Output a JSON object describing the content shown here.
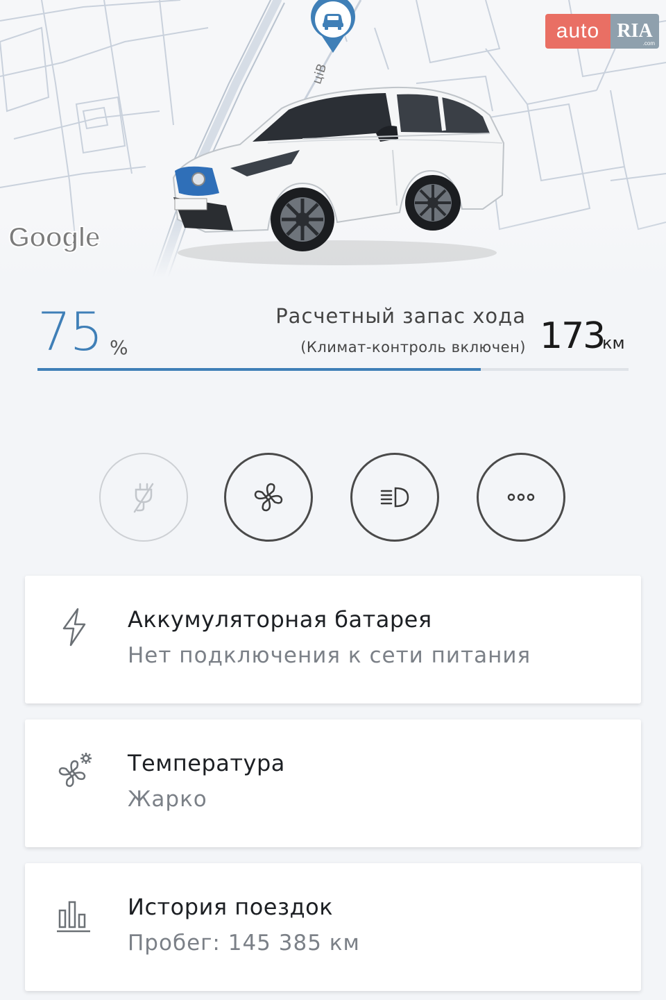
{
  "header": {
    "map_attribution": "Google",
    "street_fragment": "ціВ",
    "brand": {
      "auto": "auto",
      "ria": "RIA",
      "ria_domain": ".com"
    }
  },
  "battery": {
    "percent": "75",
    "percent_unit": "%",
    "charge_fraction": 0.75,
    "range_title": "Расчетный запас хода",
    "range_subtitle": "(Климат-контроль включен)",
    "range_value": "173",
    "range_unit": "км"
  },
  "actions": [
    {
      "name": "charging",
      "icon": "plug-off-icon",
      "enabled": false
    },
    {
      "name": "climate",
      "icon": "fan-icon",
      "enabled": true
    },
    {
      "name": "headlights",
      "icon": "headlights-icon",
      "enabled": true
    },
    {
      "name": "more",
      "icon": "more-dots-icon",
      "enabled": true
    }
  ],
  "cards": [
    {
      "icon": "lightning-icon",
      "title": "Аккумуляторная батарея",
      "subtitle": "Нет подключения к сети питания"
    },
    {
      "icon": "fan-settings-icon",
      "title": "Температура",
      "subtitle": "Жарко"
    },
    {
      "icon": "bar-chart-icon",
      "title": "История поездок",
      "subtitle": "Пробег: 145 385 км"
    }
  ],
  "colors": {
    "accent": "#3f7fb7",
    "track": "#dfe3e8",
    "background": "#f3f5f8"
  }
}
